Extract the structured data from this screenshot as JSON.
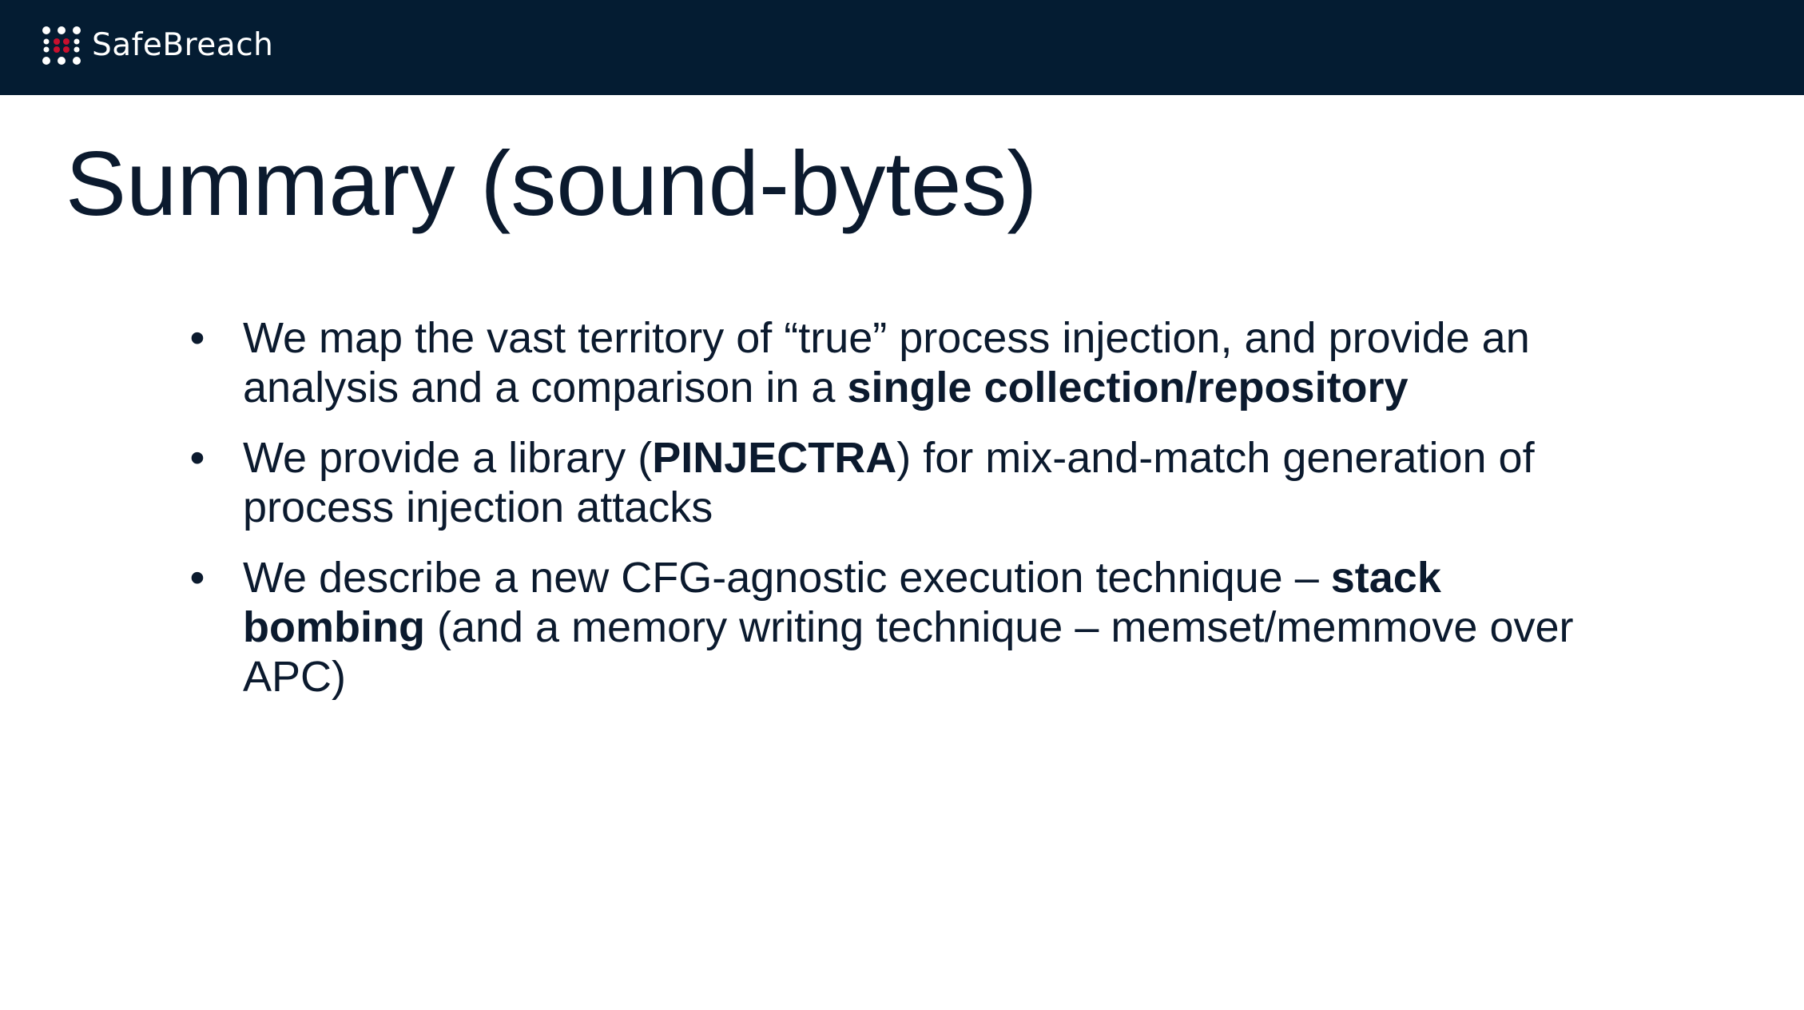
{
  "header": {
    "logo_text": "SafeBreach",
    "background_color": "#041c32",
    "logo_accent_color": "#c8102e",
    "logo_icon": "dot-grid-logo-icon"
  },
  "title": "Summary (sound-bytes)",
  "bullet_symbol": "•",
  "bullets": [
    {
      "text_pre": "We map the vast territory of “true” process injection, and provide an analysis and a comparison in a ",
      "bold_1": "single collection/repository"
    },
    {
      "text_pre": "We provide a library (",
      "bold_1": "PINJECTRA",
      "text_post": ") for mix-and-match generation of process injection attacks"
    },
    {
      "text_pre": "We describe a new CFG-agnostic execution technique – ",
      "bold_1": "stack bombing",
      "text_post": " (and a memory writing technique – memset/memmove over APC)"
    }
  ]
}
